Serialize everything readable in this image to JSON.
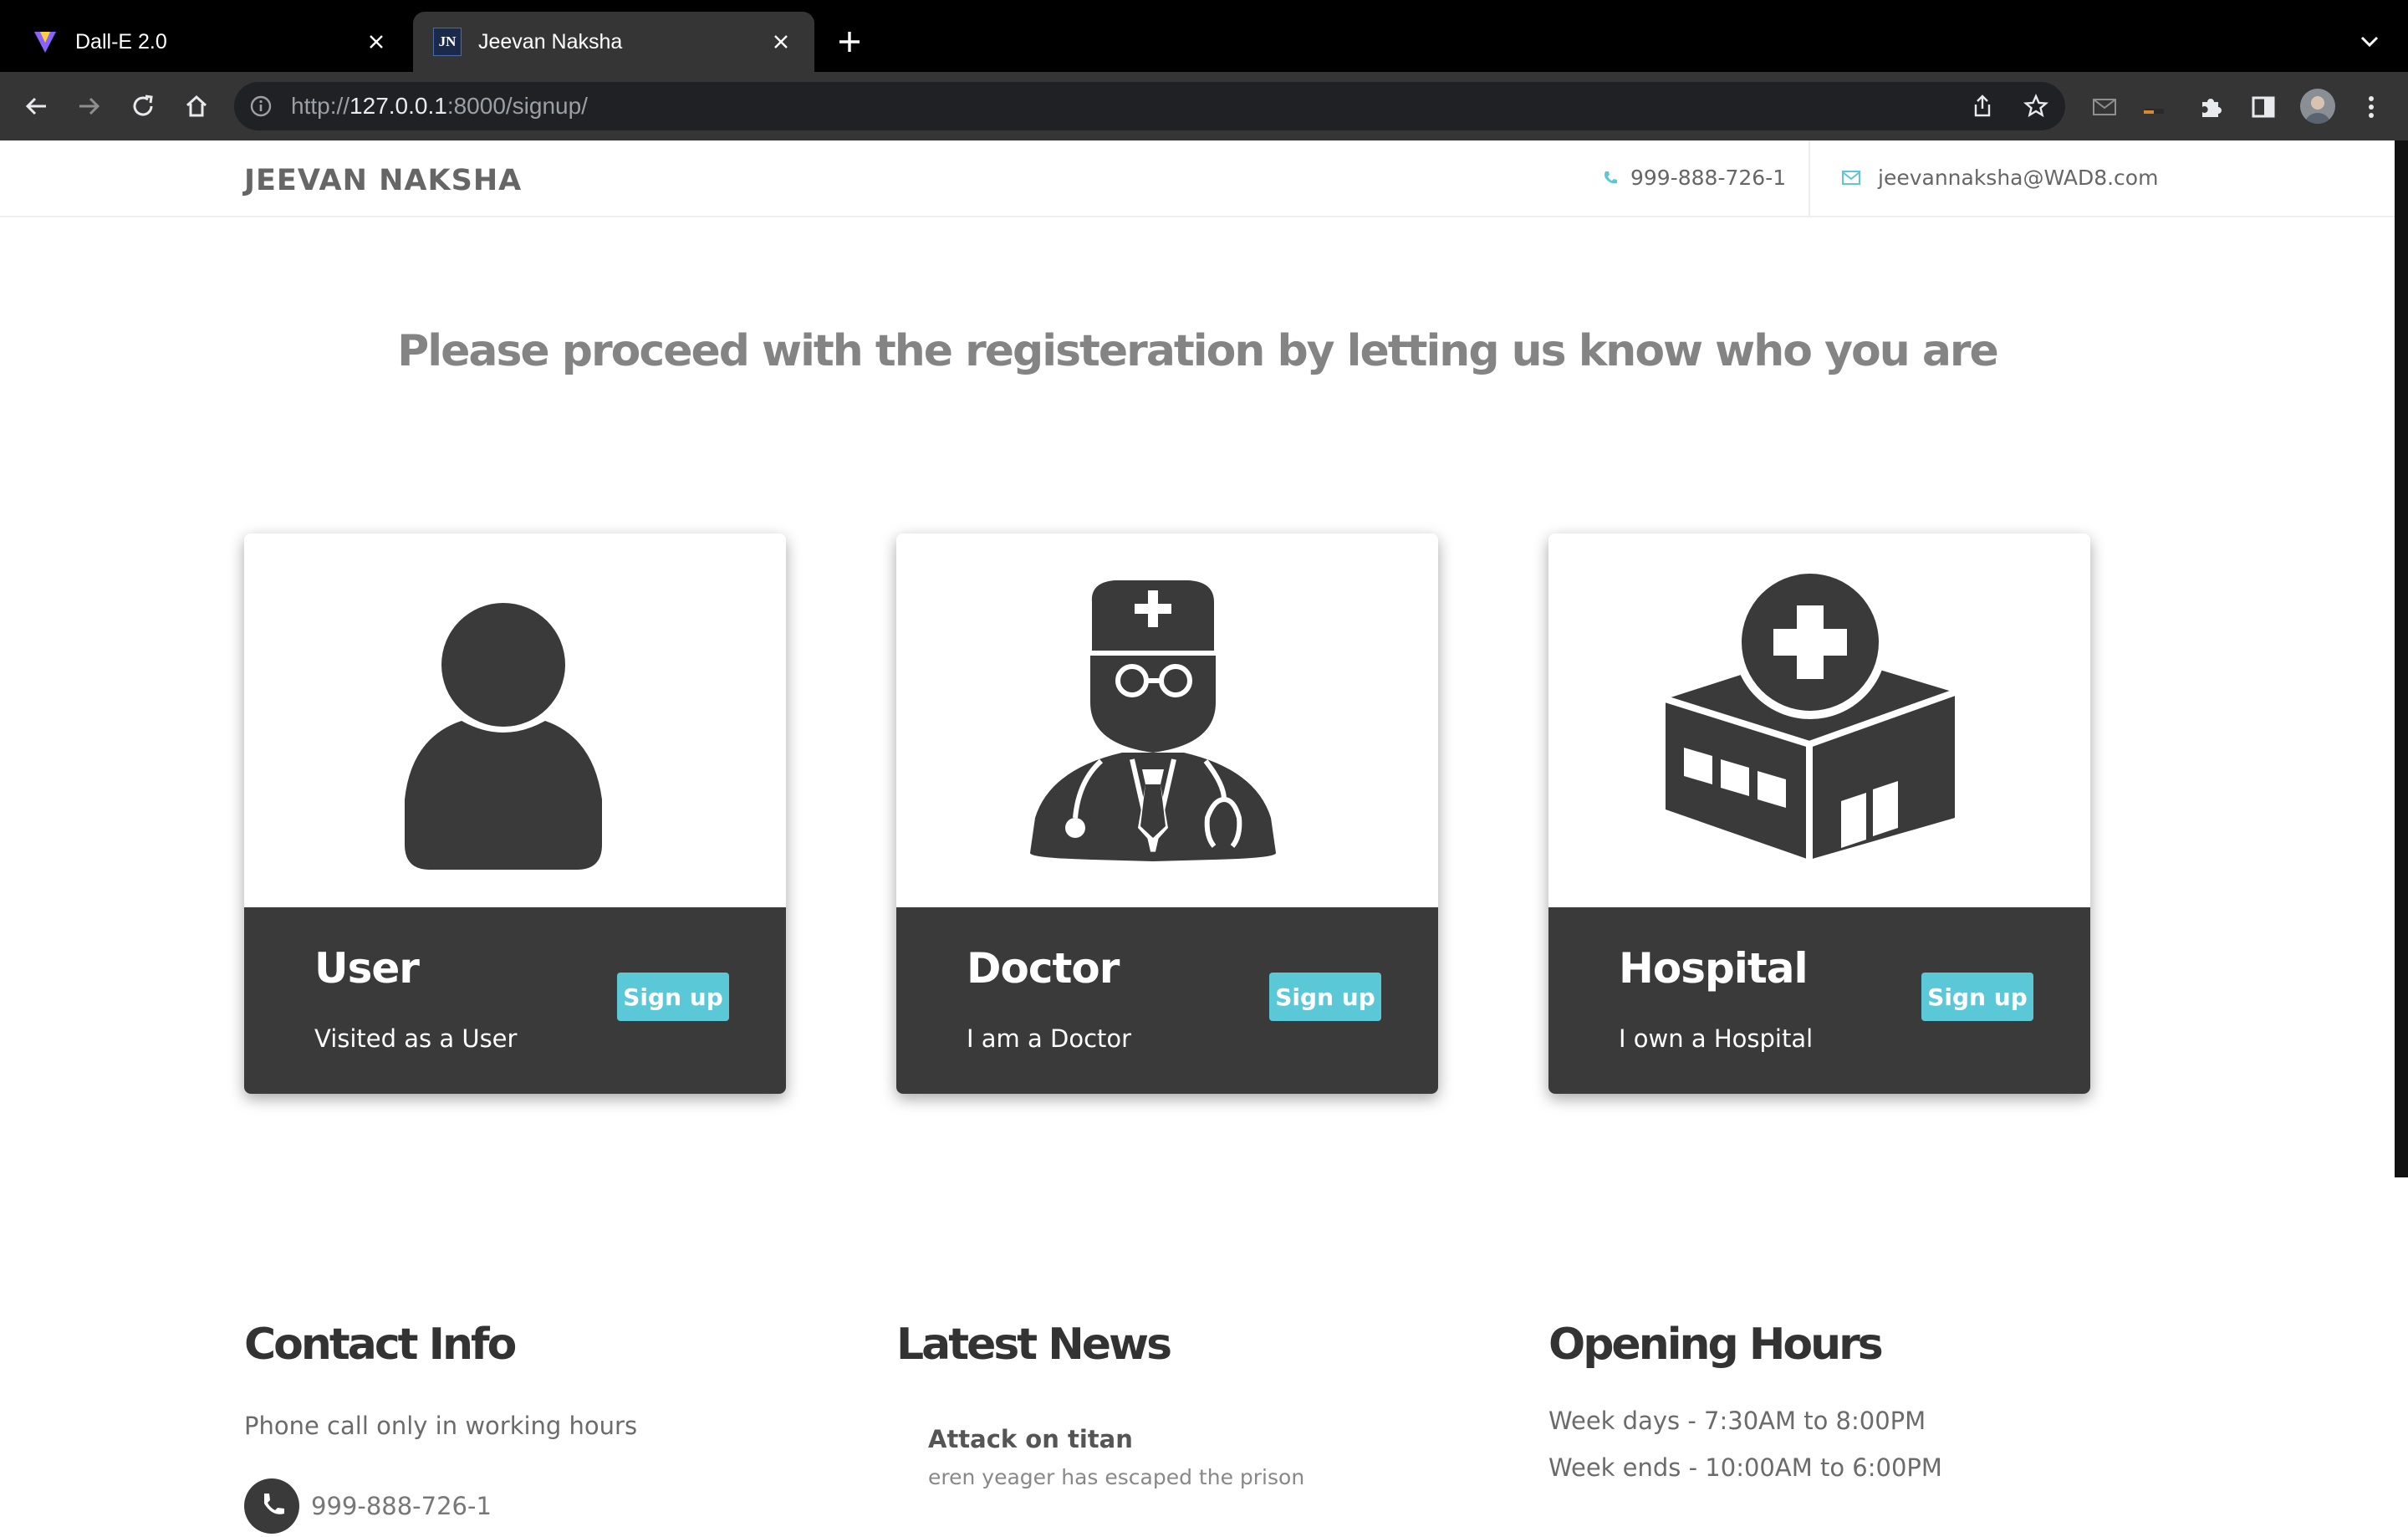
{
  "browser": {
    "tabs": [
      {
        "title": "Dall-E 2.0",
        "favicon": "vite-logo-icon",
        "active": false
      },
      {
        "title": "Jeevan Naksha",
        "favicon": "jn-logo-icon",
        "active": true
      }
    ],
    "url": {
      "scheme": "http://",
      "host": "127.0.0.1",
      "rest": ":8000/signup/"
    },
    "favicon_text": "JN"
  },
  "site": {
    "brand": "JEEVAN NAKSHA",
    "phone": "999-888-726-1",
    "email": "jeevannaksha@WAD8.com",
    "accent_color": "#5bc8d8"
  },
  "main": {
    "heading": "Please proceed with the registeration by letting us know who you are",
    "cards": [
      {
        "name": "User",
        "description": "Visited as a User",
        "button": "Sign up",
        "icon": "user-icon"
      },
      {
        "name": "Doctor",
        "description": "I am a Doctor",
        "button": "Sign up",
        "icon": "doctor-icon"
      },
      {
        "name": "Hospital",
        "description": "I own a Hospital",
        "button": "Sign up",
        "icon": "hospital-icon"
      }
    ]
  },
  "footer": {
    "contact": {
      "title": "Contact Info",
      "text": "Phone call only in working hours",
      "phone": "999-888-726-1"
    },
    "news": {
      "title": "Latest News",
      "items": [
        {
          "title": "Attack on titan",
          "body": "eren yeager has escaped the prison"
        }
      ]
    },
    "hours": {
      "title": "Opening Hours",
      "weekdays": "Week days - 7:30AM to 8:00PM",
      "weekends": "Week ends - 10:00AM to 6:00PM"
    }
  }
}
